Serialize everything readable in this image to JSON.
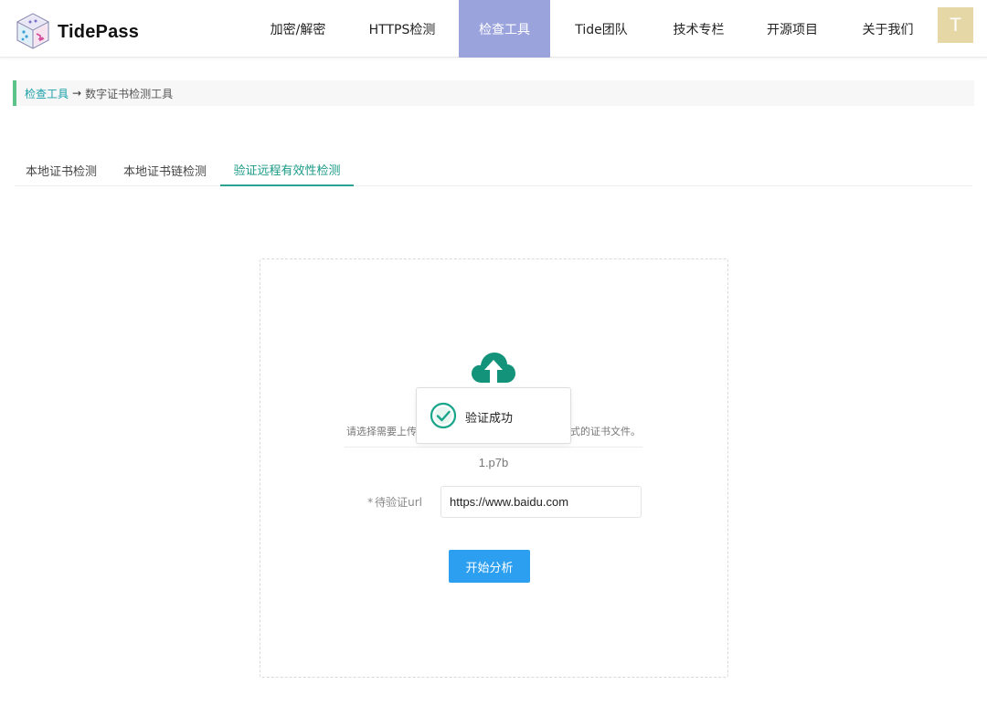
{
  "app": {
    "brand": "TidePass",
    "logo_icon": "tidepass-cube-logo",
    "avatar_letter": "T",
    "avatar_color": "#e6d7a6"
  },
  "nav": {
    "items": [
      {
        "label": "加密/解密",
        "active": false
      },
      {
        "label": "HTTPS检测",
        "active": false
      },
      {
        "label": "检查工具",
        "active": true
      },
      {
        "label": "Tide团队",
        "active": false
      },
      {
        "label": "技术专栏",
        "active": false
      },
      {
        "label": "开源项目",
        "active": false
      },
      {
        "label": "关于我们",
        "active": false
      }
    ],
    "active_color": "#9ba3dd"
  },
  "breadcrumb": {
    "parent": "检查工具",
    "separator": "→",
    "current": "数字证书检测工具",
    "accent_color": "#5cc48a"
  },
  "tabs": [
    {
      "label": "本地证书检测",
      "active": false
    },
    {
      "label": "本地证书链检测",
      "active": false
    },
    {
      "label": "验证远程有效性检测",
      "active": true
    }
  ],
  "upload": {
    "icon": "cloud-upload-icon",
    "hint_prefix": "请选择需要上传",
    "hint_suffix": "式的证书文件。",
    "file_name": "1.p7b"
  },
  "form": {
    "required_mark": "*",
    "url_label": "待验证url",
    "url_value": "https://www.baidu.com",
    "submit_label": "开始分析"
  },
  "toast": {
    "icon": "check-circle-icon",
    "message": "验证成功"
  },
  "colors": {
    "accent_teal": "#1a9a86",
    "primary_button": "#2d9ff0",
    "cloud_icon": "#13937a"
  }
}
